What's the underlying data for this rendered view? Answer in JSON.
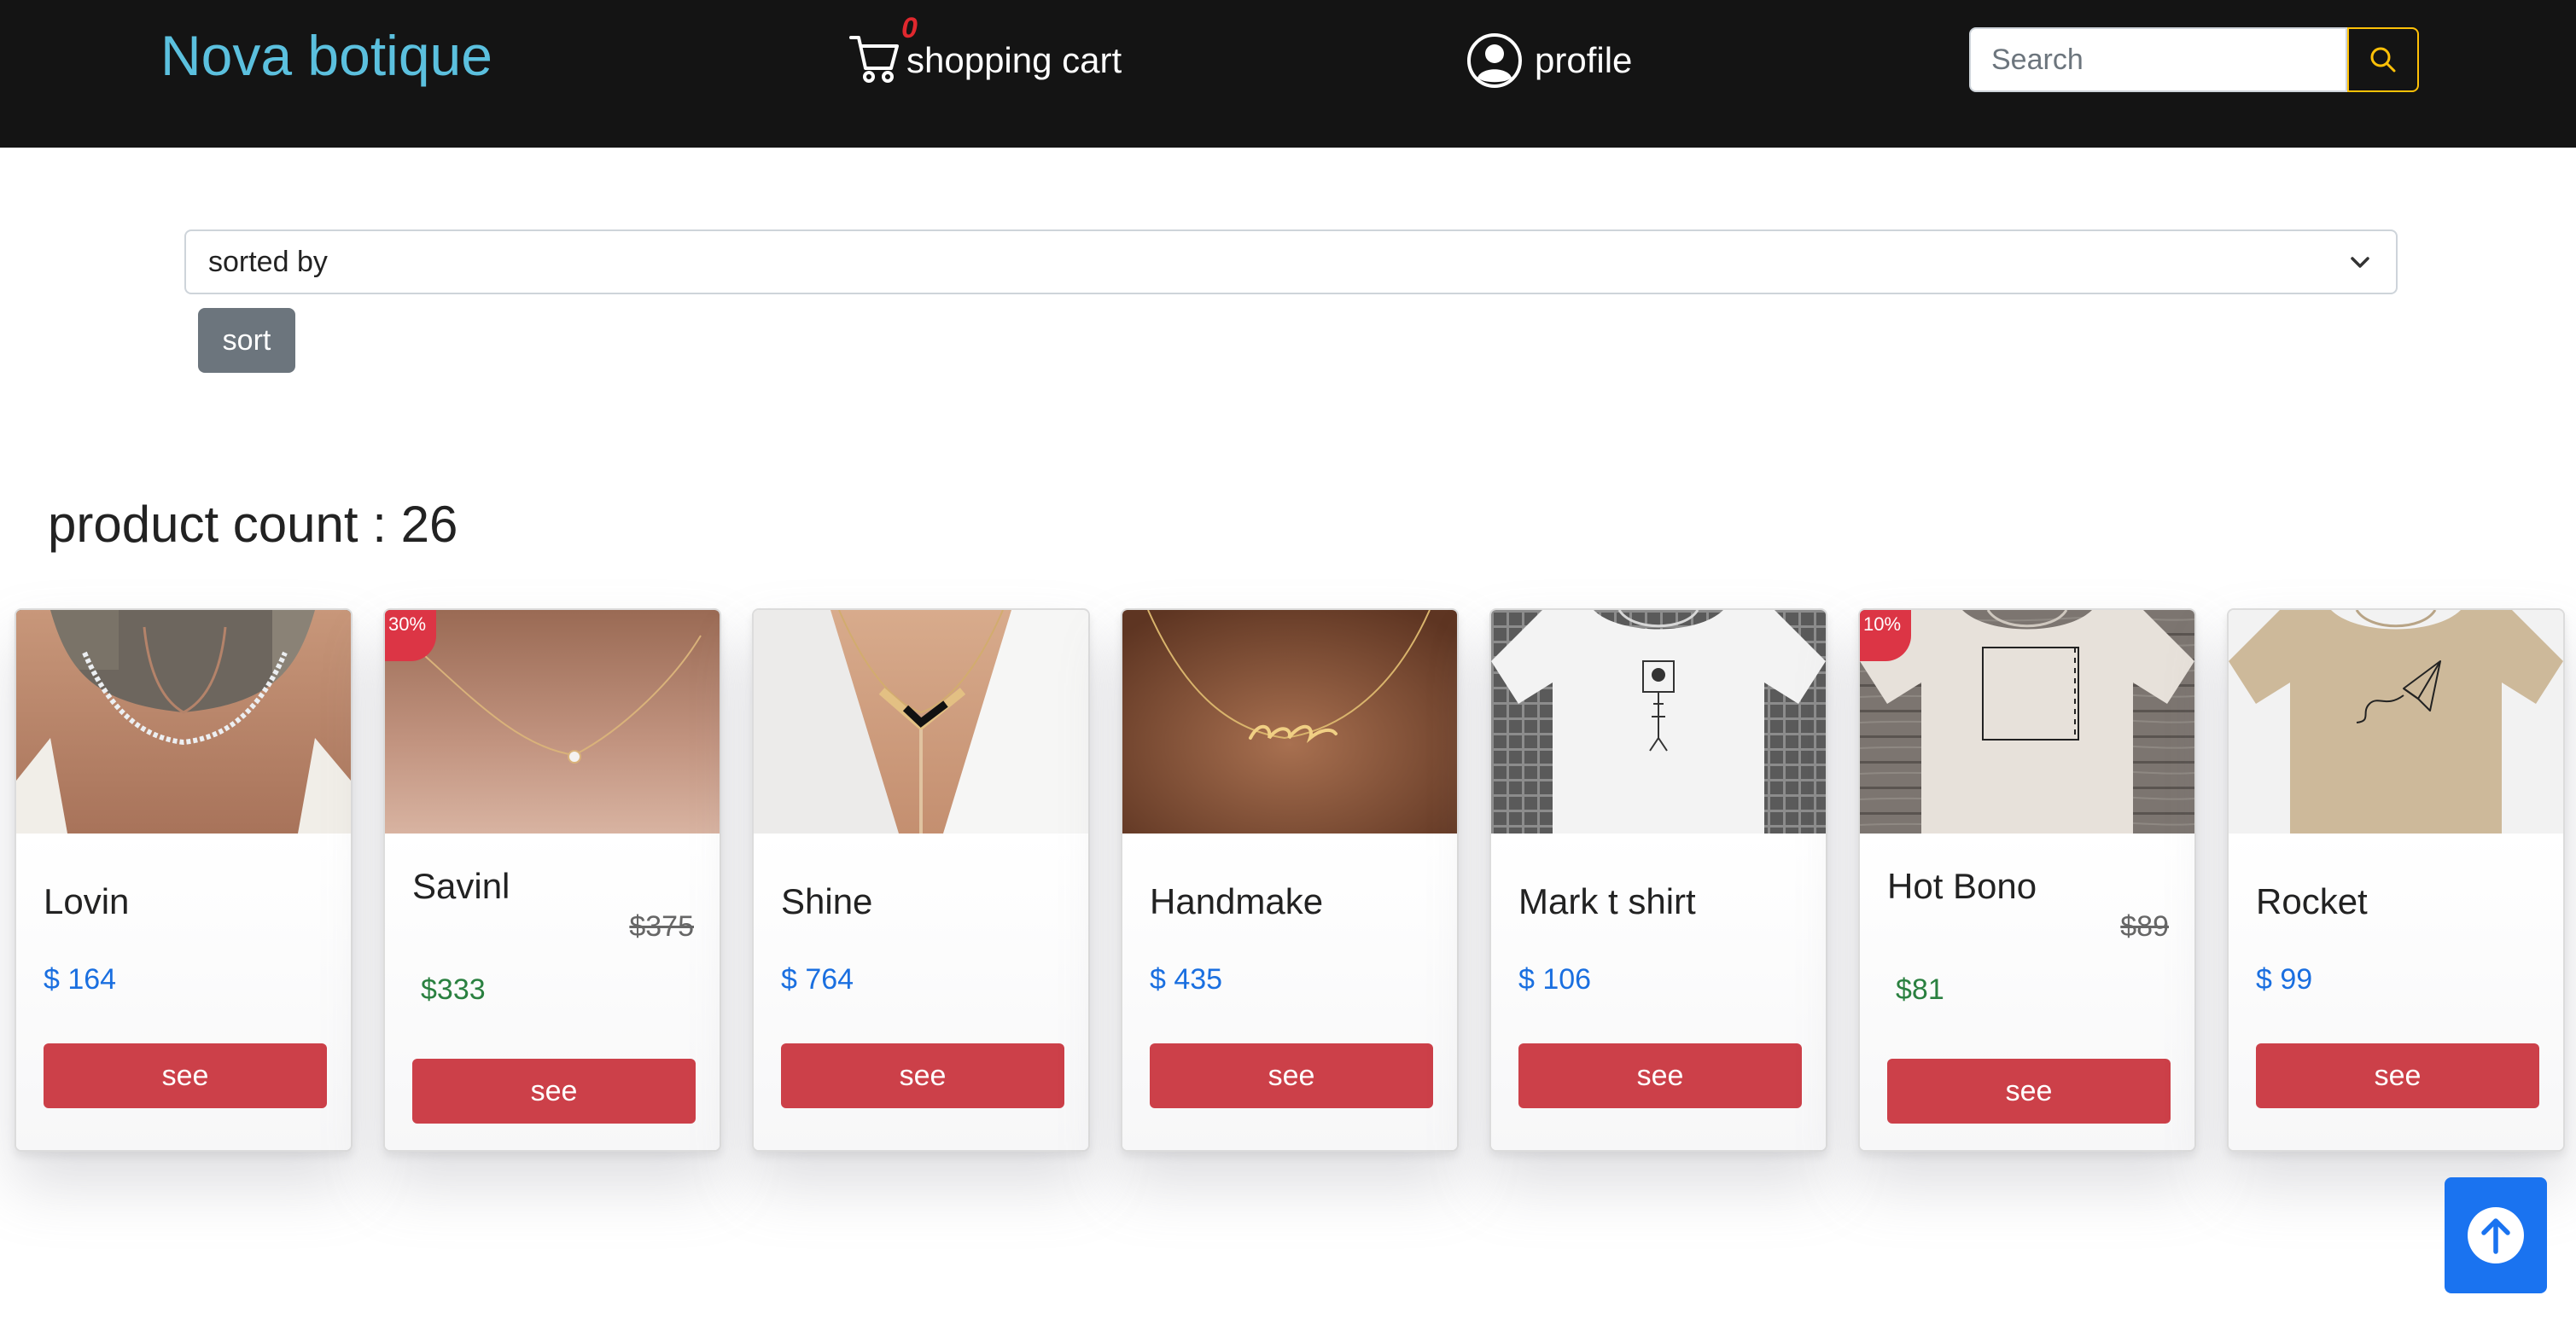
{
  "header": {
    "brand": "Nova botique",
    "cart_label": "shopping cart",
    "cart_count": "0",
    "profile_label": "profile",
    "search_placeholder": "Search",
    "search_value": ""
  },
  "sort": {
    "select_value": "sorted by",
    "button_label": "sort"
  },
  "product_count_text": "product count : 26",
  "products": [
    {
      "name": "Lovin",
      "price": "$ 164",
      "image": "necklace-tennis"
    },
    {
      "name": "Savinl",
      "old_price": "$375",
      "new_price": "$333",
      "discount": "30%",
      "image": "necklace-solitaire"
    },
    {
      "name": "Shine",
      "price": "$ 764",
      "image": "necklace-v-layered"
    },
    {
      "name": "Handmake",
      "price": "$ 435",
      "image": "necklace-name"
    },
    {
      "name": "Mark t shirt",
      "price": "$ 106",
      "image": "tshirt-white-print"
    },
    {
      "name": "Hot Bono",
      "old_price": "$89",
      "new_price": "$81",
      "discount": "10%",
      "image": "tshirt-square-print"
    },
    {
      "name": "Rocket",
      "price": "$ 99",
      "image": "tshirt-beige-paperplane"
    }
  ],
  "product_button_label": "see",
  "colors": {
    "navbar": "#141414",
    "brand": "#5bc0de",
    "cart_badge": "#e0282e",
    "search_button_border": "#ffc107",
    "sort_button": "#6c757d",
    "price": "#1a6fe0",
    "discounted_price": "#2a8040",
    "see_button": "#cc4049",
    "discount_badge": "#dc3545",
    "back_to_top": "#1a73f0"
  },
  "icons": {
    "cart": "cart-icon",
    "profile": "user-circle-icon",
    "search": "search-icon",
    "select": "chevron-down-icon",
    "back_to_top": "arrow-up-circle-icon"
  }
}
